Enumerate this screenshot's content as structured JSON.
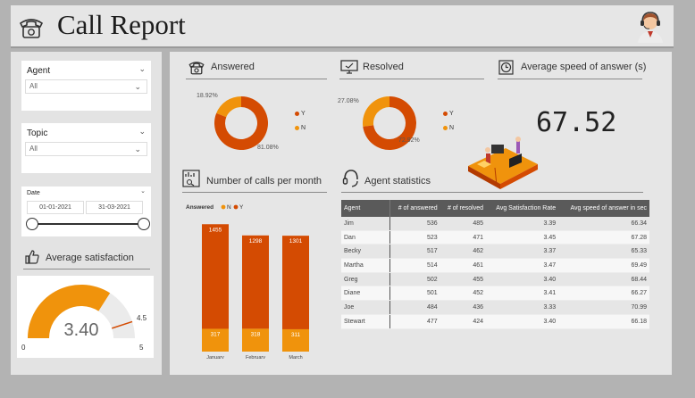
{
  "header": {
    "title": "Call Report"
  },
  "colors": {
    "orange_dark": "#d44b02",
    "orange_light": "#f0930c",
    "header_bg": "#5a5a5a"
  },
  "sidebar": {
    "agent": {
      "title": "Agent",
      "value": "All"
    },
    "topic": {
      "title": "Topic",
      "value": "All"
    },
    "date": {
      "title": "Date",
      "start": "01-01-2021",
      "end": "31-03-2021"
    },
    "satisfaction": {
      "title": "Average satisfaction",
      "value": "3.40",
      "min": "0",
      "max": "5",
      "target": "4.5"
    }
  },
  "answered": {
    "title": "Answered",
    "pct_n": "18.92%",
    "pct_y": "81.08%",
    "legend_y": "Y",
    "legend_n": "N"
  },
  "resolved": {
    "title": "Resolved",
    "pct_n": "27.08%",
    "pct_y": "72.92%",
    "legend_y": "Y",
    "legend_n": "N"
  },
  "speed": {
    "title": "Average speed of answer (s)",
    "value": "67.52"
  },
  "calls_per_month": {
    "title": "Number of calls per month"
  },
  "agent_stats": {
    "title": "Agent statistics",
    "columns": [
      "Agent",
      "# of answered",
      "# of resolved",
      "Avg Satisfaction Rate",
      "Avg speed of answer in sec"
    ],
    "rows": [
      [
        "Jim",
        "536",
        "485",
        "3.39",
        "66.34"
      ],
      [
        "Dan",
        "523",
        "471",
        "3.45",
        "67.28"
      ],
      [
        "Becky",
        "517",
        "462",
        "3.37",
        "65.33"
      ],
      [
        "Martha",
        "514",
        "461",
        "3.47",
        "69.49"
      ],
      [
        "Greg",
        "502",
        "455",
        "3.40",
        "68.44"
      ],
      [
        "Diane",
        "501",
        "452",
        "3.41",
        "66.27"
      ],
      [
        "Joe",
        "484",
        "436",
        "3.33",
        "70.99"
      ],
      [
        "Stewart",
        "477",
        "424",
        "3.40",
        "66.18"
      ]
    ]
  },
  "chart_data": {
    "type": "bar",
    "stacked": true,
    "categories": [
      "January",
      "February",
      "March"
    ],
    "series": [
      {
        "name": "N",
        "values": [
          317,
          318,
          311
        ]
      },
      {
        "name": "Y",
        "values": [
          1455,
          1298,
          1301
        ]
      }
    ],
    "legend_title": "Answered",
    "legend_position": "top-left"
  }
}
